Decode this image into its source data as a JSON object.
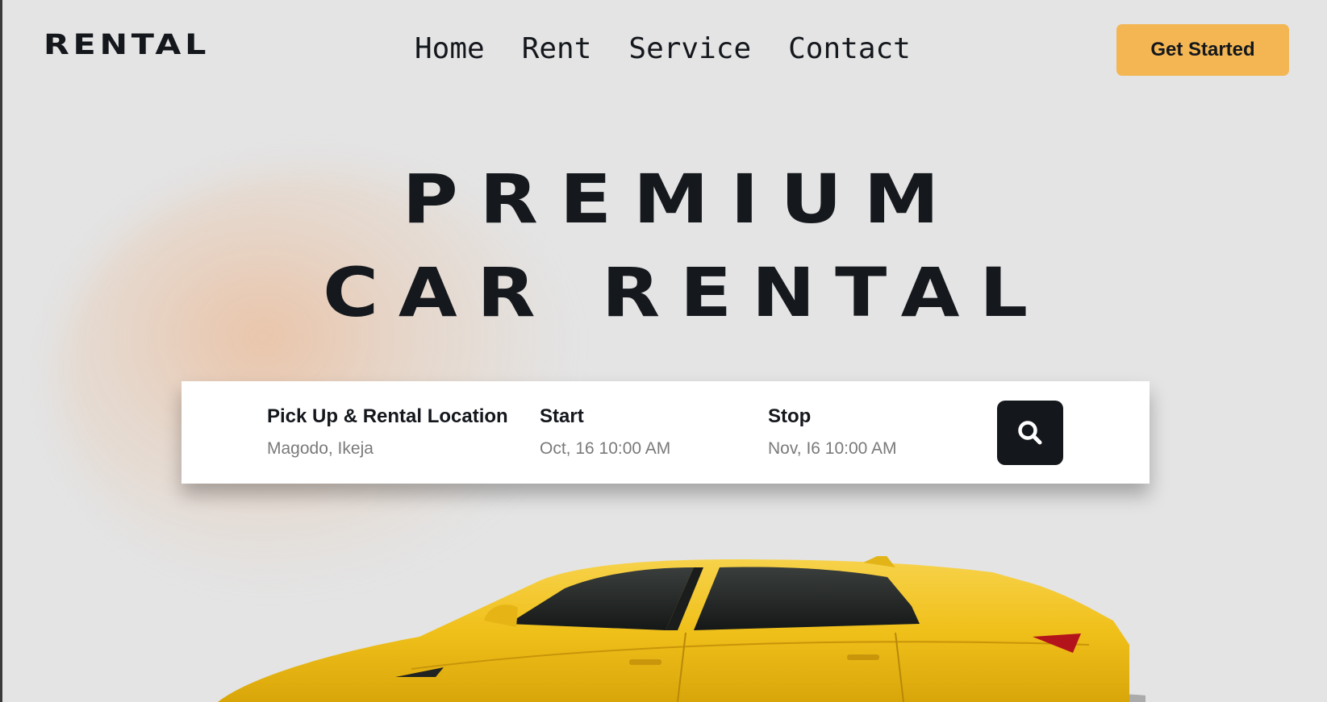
{
  "header": {
    "logo": "RENTAL",
    "nav": [
      "Home",
      "Rent",
      "Service",
      "Contact"
    ],
    "cta_label": "Get Started"
  },
  "hero": {
    "line1": "PREMIUM",
    "line2": "CAR RENTAL"
  },
  "search": {
    "location": {
      "label": "Pick Up & Rental Location",
      "value": "Magodo, Ikeja"
    },
    "start": {
      "label": "Start",
      "value": "Oct, 16 10:00 AM"
    },
    "stop": {
      "label": "Stop",
      "value": "Nov, I6 10:00 AM"
    },
    "button_icon": "search-icon"
  },
  "colors": {
    "background": "#e4e4e4",
    "accent": "#f3b653",
    "dark": "#14171c",
    "car": "#f2c21c"
  }
}
